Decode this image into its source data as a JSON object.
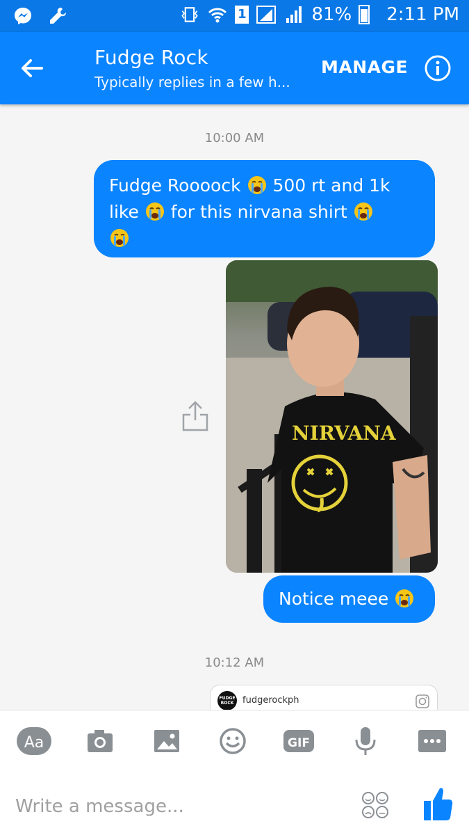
{
  "status_bar": {
    "battery_percent": "81%",
    "time": "2:11 PM",
    "sim_slot": "1",
    "icons": [
      "messenger-icon",
      "wrench-icon",
      "vibrate-icon",
      "wifi-icon",
      "sim-icon",
      "signal-icon",
      "signal-icon",
      "battery-icon"
    ]
  },
  "header": {
    "title": "Fudge Rock",
    "subtitle": "Typically replies in a few h...",
    "manage_label": "MANAGE",
    "back_icon": "back-arrow-icon",
    "info_icon": "info-icon"
  },
  "messages": {
    "timestamp_1": "10:00 AM",
    "bubble_1": {
      "line_1": "Fudge Roooock",
      "line_1b": "500 rt and 1k",
      "line_2a": "like",
      "line_2b": "for this nirvana shirt"
    },
    "bubble_2": "Notice meee",
    "timestamp_2": "10:12 AM",
    "shared_post": {
      "handle": "fudgerockph",
      "avatar_text": "FUDGE ROCK"
    }
  },
  "composer": {
    "placeholder": "Write a message...",
    "aa_label": "Aa",
    "gif_label": "GIF",
    "tools": [
      "text-format-button",
      "camera-button",
      "gallery-button",
      "sticker-button",
      "gif-button",
      "microphone-button",
      "more-button"
    ]
  },
  "colors": {
    "brand_blue": "#0a84ff",
    "status_bar_blue": "#0a78e6",
    "bubble_text": "#ffffff",
    "timestamp_gray": "#8a8a8a",
    "toolbar_gray": "#8a8f94"
  }
}
